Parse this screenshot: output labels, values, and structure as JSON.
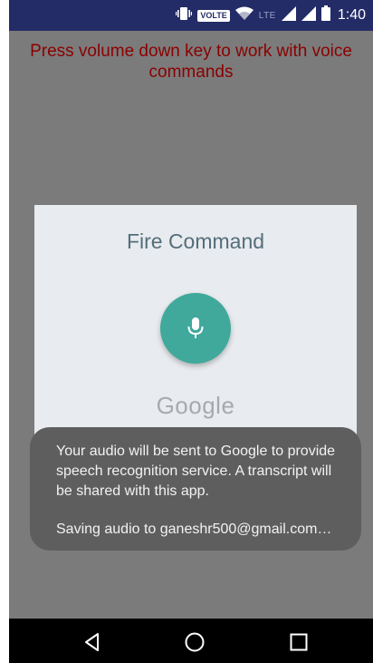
{
  "status_bar": {
    "volte_badge": "VOLTE",
    "network_type": "LTE",
    "time": "1:40",
    "icons": [
      "vibrate-icon",
      "wifi-icon",
      "signal-icon",
      "signal-icon",
      "battery-icon"
    ]
  },
  "app": {
    "hint_text": "Press volume down key to work with voice commands"
  },
  "dialog": {
    "title": "Fire Command",
    "mic_icon": "microphone-icon",
    "mic_color": "#40a99b",
    "brand": "Google"
  },
  "toast": {
    "message": "Your audio will be sent to Google to provide speech recognition service. A transcript will be shared with this app.",
    "saving_text": "Saving audio to ganeshr500@gmail.com…"
  },
  "nav_bar": {
    "icons": [
      "back-icon",
      "home-icon",
      "recents-icon"
    ]
  }
}
